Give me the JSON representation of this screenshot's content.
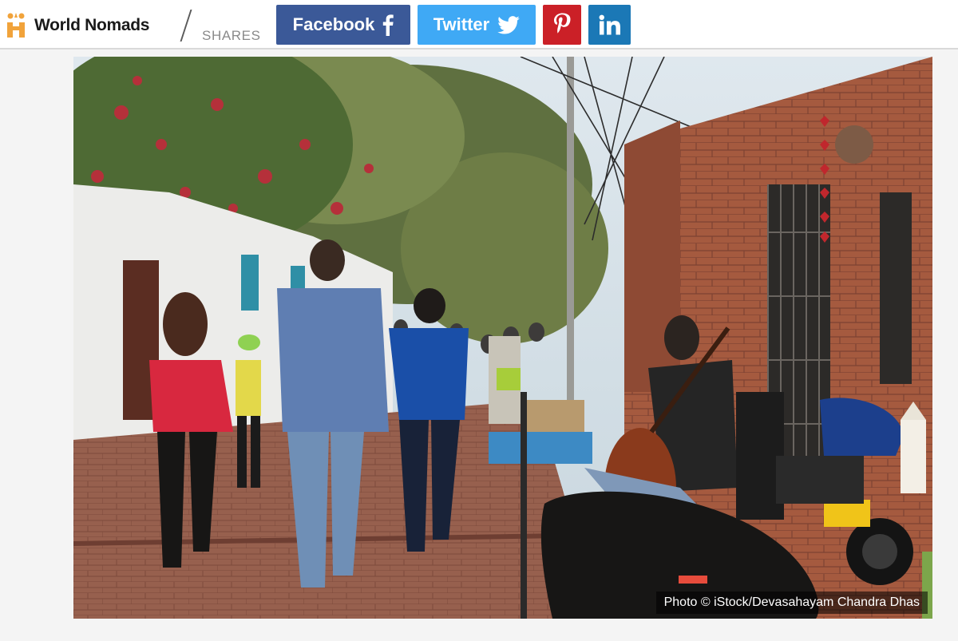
{
  "site": {
    "name": "World Nomads"
  },
  "share_bar": {
    "label": "SHARES",
    "buttons": [
      {
        "label": "Facebook",
        "icon": "facebook-icon",
        "color": "#3b5998"
      },
      {
        "label": "Twitter",
        "icon": "twitter-icon",
        "color": "#3fa9f5"
      },
      {
        "label": "",
        "icon": "pinterest-icon",
        "color": "#cb2027"
      },
      {
        "label": "",
        "icon": "linkedin-icon",
        "color": "#1b78b6"
      }
    ]
  },
  "photo": {
    "credit": "Photo © iStock/Devasahayam Chandra Dhas"
  }
}
